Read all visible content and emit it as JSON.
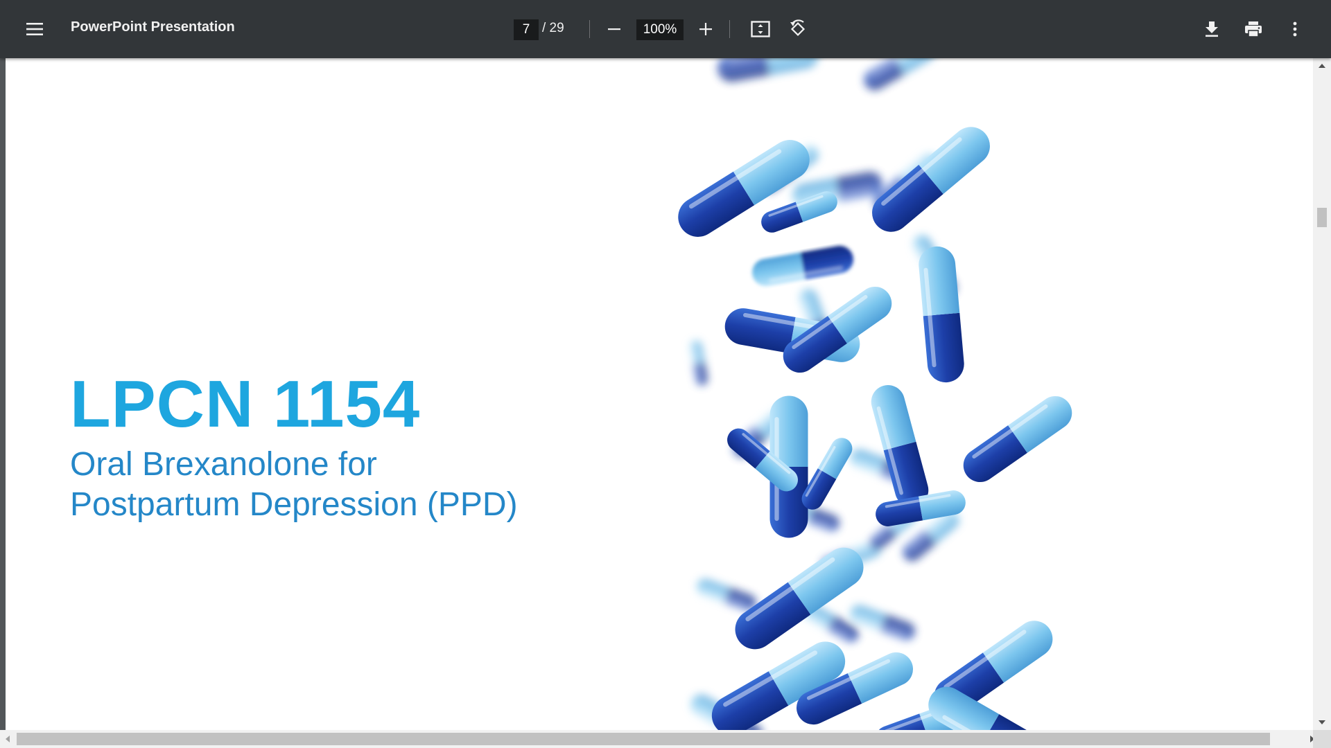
{
  "toolbar": {
    "menu_icon": "hamburger-menu-icon",
    "title": "PowerPoint Presentation",
    "page_current": "7",
    "page_total": "/ 29",
    "zoom_value": "100%",
    "zoom_out_icon": "minus-icon",
    "zoom_in_icon": "plus-icon",
    "fit_icon": "fit-to-page-icon",
    "rotate_icon": "rotate-counterclockwise-icon",
    "download_icon": "download-icon",
    "print_icon": "print-icon",
    "more_icon": "more-vertical-icon"
  },
  "slide": {
    "title": "LPCN 1154",
    "subtitle_line1": "Oral Brexanolone for",
    "subtitle_line2": "Postpartum Depression (PPD)",
    "image": "blue-capsule-pills-image"
  },
  "colors": {
    "toolbar_bg": "#323639",
    "viewer_bg": "#525659",
    "title_color": "#1ea6df",
    "subtitle_color": "#2487c8",
    "pill_dark": "#1d3fa8",
    "pill_light": "#7cc6ee"
  }
}
